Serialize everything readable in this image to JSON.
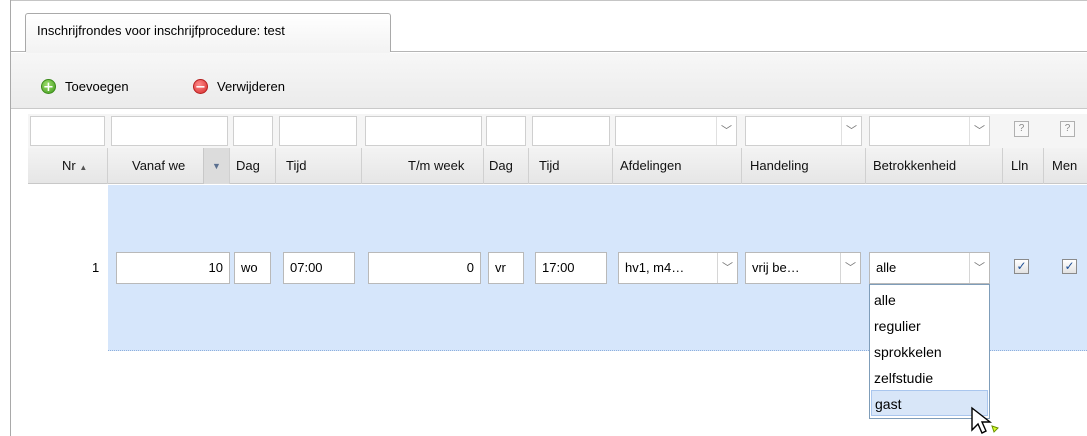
{
  "tab": {
    "label": "Inschrijfrondes voor inschrijfprocedure: test"
  },
  "toolbar": {
    "add_label": "Toevoegen",
    "delete_label": "Verwijderen",
    "add_icon": "plus-icon",
    "delete_icon": "minus-icon"
  },
  "filter_help": "?",
  "columns": {
    "nr": "Nr",
    "vanaf_week": "Vanaf we",
    "dag1": "Dag",
    "tijd1": "Tijd",
    "tm_week": "T/m week",
    "dag2": "Dag",
    "tijd2": "Tijd",
    "afdelingen": "Afdelingen",
    "handeling": "Handeling",
    "betrokkenheid": "Betrokkenheid",
    "lln": "Lln",
    "men": "Men"
  },
  "row": {
    "nr": "1",
    "vanaf_week": "10",
    "dag1": "wo",
    "tijd1": "07:00",
    "tm_week": "0",
    "dag2": "vr",
    "tijd2": "17:00",
    "afdelingen": "hv1, m4…",
    "handeling": "vrij be…",
    "betrokkenheid": "alle",
    "lln_checked": true,
    "men_checked": true
  },
  "dropdown": {
    "options": [
      "alle",
      "regulier",
      "sprokkelen",
      "zelfstudie",
      "gast"
    ],
    "hovered": "gast"
  },
  "colors": {
    "row_selected": "#d6e6fb",
    "dropdown_hover": "#d8e6f8",
    "add": "#3f9a1b",
    "delete": "#d62a2a"
  }
}
